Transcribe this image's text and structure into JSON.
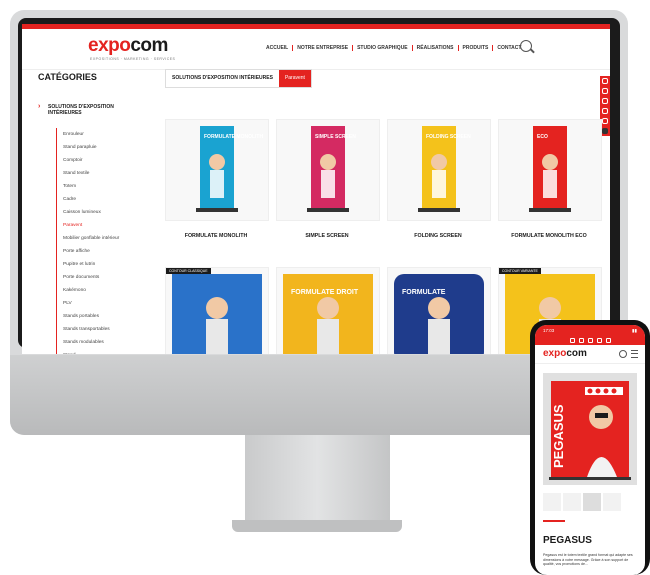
{
  "site": {
    "logo_main": "expo",
    "logo_accent": "com",
    "tagline": "EXPOSITIONS · MARKETING · SERVICES"
  },
  "nav": [
    "ACCUEIL",
    "NOTRE ENTREPRISE",
    "STUDIO GRAPHIQUE",
    "RÉALISATIONS",
    "PRODUITS",
    "CONTACT"
  ],
  "sidebar": {
    "title": "CATÉGORIES",
    "section": "SOLUTIONS D'EXPOSITION INTÉRIEURES",
    "items": [
      "Enrouleur",
      "Stand parapluie",
      "Comptoir",
      "Stand textile",
      "Totem",
      "Cadre",
      "Caisson lumineux",
      "Paravent",
      "Mobilier gonflable intérieur",
      "Porte affiche",
      "Pupitre et lutrin",
      "Porte documents",
      "Kakémono",
      "PLV",
      "Stands portables",
      "Stands transportables",
      "Stands modulables",
      "Stand"
    ],
    "active_index": 7
  },
  "tabs": {
    "breadcrumb": "SOLUTIONS D'EXPOSITION INTÉRIEURES",
    "current": "Paravent"
  },
  "products": [
    {
      "label": "FORMULATE MONOLITH",
      "banner_text": "FORMULATE MONOLITH",
      "color": "#1aa3d1"
    },
    {
      "label": "SIMPLE SCREEN",
      "banner_text": "SIMPLE SCREEN",
      "color": "#d42a62"
    },
    {
      "label": "FOLDING SCREEN",
      "banner_text": "FOLDING SCREEN",
      "color": "#f4c21b"
    },
    {
      "label": "FORMULATE MONOLITH ECO",
      "banner_text": "ECO",
      "color": "#e42320"
    },
    {
      "label": "",
      "banner_text": "",
      "badge": "CONTOUR CLASSIQUE",
      "color": "#2a72c9"
    },
    {
      "label": "",
      "banner_text": "FORMULATE DROIT",
      "color": "#f2b51d"
    },
    {
      "label": "",
      "banner_text": "FORMULATE",
      "color": "#1f3c8c"
    },
    {
      "label": "",
      "banner_text": "",
      "badge": "CONTOUR VARIANTE",
      "color": "#f4c21b"
    }
  ],
  "phone": {
    "time": "17:03",
    "logo_main": "expo",
    "logo_accent": "com",
    "product_banner": "PEGASUS",
    "product_title": "PEGASUS",
    "description": "Pegasus est le totem textile grand format qui adapte ses dimensions à votre message. Grâce à son support de qualité, vos promotions de..."
  },
  "colors": {
    "brand": "#e42320",
    "dark": "#1b1b1b"
  }
}
